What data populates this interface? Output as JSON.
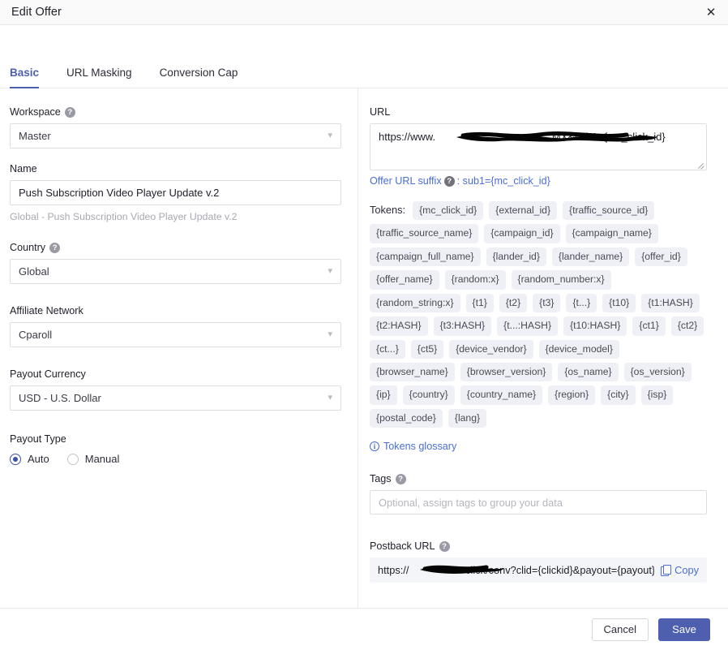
{
  "dialog": {
    "title": "Edit Offer",
    "close_label": "✕"
  },
  "tabs": [
    {
      "label": "Basic",
      "active": true
    },
    {
      "label": "URL Masking",
      "active": false
    },
    {
      "label": "Conversion Cap",
      "active": false
    }
  ],
  "left": {
    "workspace": {
      "label": "Workspace",
      "help": "?",
      "value": "Master"
    },
    "name": {
      "label": "Name",
      "value": "Push Subscription Video Player Update v.2",
      "hint": "Global - Push Subscription Video Player Update v.2"
    },
    "country": {
      "label": "Country",
      "help": "?",
      "value": "Global"
    },
    "affiliate_network": {
      "label": "Affiliate Network",
      "value": "Cparoll"
    },
    "payout_currency": {
      "label": "Payout Currency",
      "value": "USD - U.S. Dollar"
    },
    "payout_type": {
      "label": "Payout Type",
      "options": [
        {
          "label": "Auto",
          "checked": true
        },
        {
          "label": "Manual",
          "checked": false
        }
      ]
    }
  },
  "right": {
    "url": {
      "label": "URL",
      "value_prefix": "https://www.",
      "value_suffix": "MX&sub1={mc_click_id}",
      "redacted": true
    },
    "suffix_line": {
      "link_text": "Offer URL suffix",
      "help": "?",
      "value": ": sub1={mc_click_id}"
    },
    "tokens": {
      "label": "Tokens:",
      "items": [
        "{mc_click_id}",
        "{external_id}",
        "{traffic_source_id}",
        "{traffic_source_name}",
        "{campaign_id}",
        "{campaign_name}",
        "{campaign_full_name}",
        "{lander_id}",
        "{lander_name}",
        "{offer_id}",
        "{offer_name}",
        "{random:x}",
        "{random_number:x}",
        "{random_string:x}",
        "{t1}",
        "{t2}",
        "{t3}",
        "{t...}",
        "{t10}",
        "{t1:HASH}",
        "{t2:HASH}",
        "{t3:HASH}",
        "{t...:HASH}",
        "{t10:HASH}",
        "{ct1}",
        "{ct2}",
        "{ct...}",
        "{ct5}",
        "{device_vendor}",
        "{device_model}",
        "{browser_name}",
        "{browser_version}",
        "{os_name}",
        "{os_version}",
        "{ip}",
        "{country}",
        "{country_name}",
        "{region}",
        "{city}",
        "{isp}",
        "{postal_code}",
        "{lang}"
      ]
    },
    "glossary": {
      "icon": "info-icon",
      "label": "Tokens glossary"
    },
    "tags": {
      "label": "Tags",
      "help": "?",
      "placeholder": "Optional, assign tags to group your data",
      "value": ""
    },
    "postback": {
      "label": "Postback URL",
      "help": "?",
      "value_prefix": "https://",
      "value_suffix": "click/conv?clid={clickid}&payout={payout}…",
      "copy_label": "Copy",
      "redacted": true
    }
  },
  "footer": {
    "cancel_label": "Cancel",
    "save_label": "Save"
  },
  "colors": {
    "accent": "#4e5fb0",
    "link": "#4a6fd4",
    "chip_bg": "#eff0f6",
    "header_bg": "#fafafa",
    "postback_bg": "#f4f5f9"
  }
}
